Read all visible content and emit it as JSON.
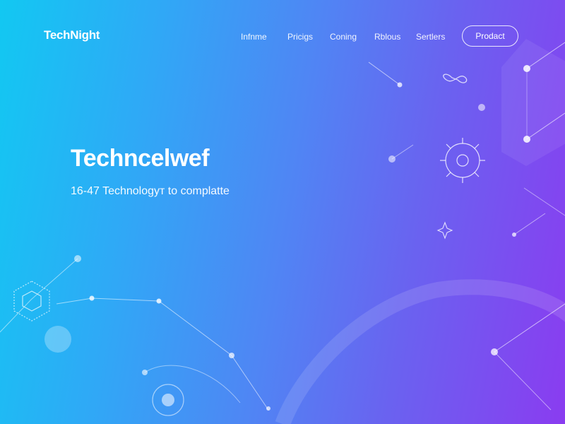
{
  "brand": {
    "name": "TechNight"
  },
  "nav": {
    "links": [
      "Infnme",
      "Pricigs",
      "Coning",
      "Rblous",
      "Sertlers"
    ],
    "cta_label": "Prodact"
  },
  "hero": {
    "title": "Techncelwef",
    "subtitle": "16-47 Technologyт to complatte"
  },
  "colors": {
    "gradient_start": "#12c8f2",
    "gradient_mid": "#4f86f4",
    "gradient_end": "#8a3cf0",
    "text": "#ffffff"
  },
  "decor_icons": [
    "hexagon-icon",
    "gear-icon",
    "infinity-icon",
    "sparkle-icon",
    "node-network"
  ]
}
